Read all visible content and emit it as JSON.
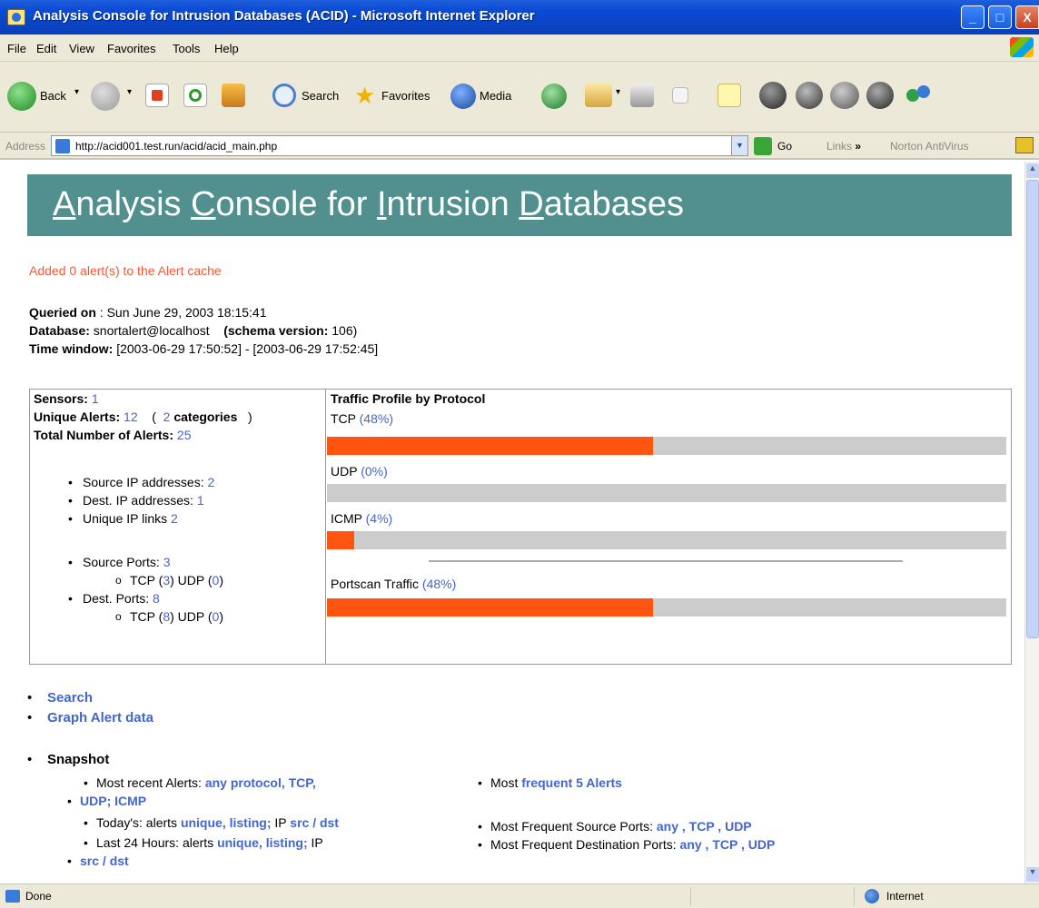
{
  "window": {
    "title": "Analysis Console for Intrusion Databases (ACID) - Microsoft Internet Explorer",
    "buttons": {
      "minimize": "_",
      "maximize": "□",
      "close": "X"
    }
  },
  "menu": [
    "File",
    "Edit",
    "View",
    "Favorites",
    "Tools",
    "Help"
  ],
  "toolbar": {
    "back": "Back",
    "search": "Search",
    "favorites": "Favorites",
    "media": "Media"
  },
  "address": {
    "label": "Address",
    "url": "http://acid001.test.run/acid/acid_main.php",
    "go": "Go",
    "links": "Links",
    "links_chevron": "»",
    "norton": "Norton AntiVirus"
  },
  "page": {
    "banner": {
      "w1_first": "A",
      "w1_rest": "nalysis ",
      "w2_first": "C",
      "w2_rest": "onsole for ",
      "w3_first": "I",
      "w3_rest": "ntrusion ",
      "w4_first": "D",
      "w4_rest": "atabases"
    },
    "cache_message": "Added 0 alert(s) to the Alert cache",
    "queried_on": {
      "label": "Queried on",
      "value": " : Sun June 29, 2003 18:15:41"
    },
    "database": {
      "label": "Database:",
      "value": " snortalert@localhost",
      "schema_label": "(schema version:",
      "schema_value": " 106)"
    },
    "time_window": {
      "label": "Time window:",
      "value": " [2003-06-29 17:50:52] - [2003-06-29 17:52:45]"
    },
    "stats": {
      "sensors": {
        "label": "Sensors:",
        "value": "1"
      },
      "unique_alerts": {
        "label": "Unique Alerts:",
        "value": "12",
        "paren_open": "(",
        "categories_value": "2",
        "categories_label": "categories",
        "paren_close": ")"
      },
      "total_alerts": {
        "label": "Total Number of Alerts:",
        "value": "25"
      },
      "src_ip": {
        "label": "Source IP addresses:",
        "value": "2"
      },
      "dst_ip": {
        "label": "Dest. IP addresses:",
        "value": "1"
      },
      "ip_links": {
        "label": "Unique IP links",
        "value": "2"
      },
      "src_ports": {
        "label": "Source Ports:",
        "value": "3",
        "tcp_label": "TCP (",
        "tcp": "3",
        "udp_label": ") UDP (",
        "udp": "0",
        "close": ")"
      },
      "dst_ports": {
        "label": "Dest. Ports:",
        "value": "8",
        "tcp_label": "TCP (",
        "tcp": "8",
        "udp_label": ") UDP (",
        "udp": "0",
        "close": ")"
      }
    },
    "traffic": {
      "title": "Traffic Profile by Protocol",
      "protocols": [
        {
          "name": "TCP",
          "pct_text": "(48%)",
          "fraction": 0.48
        },
        {
          "name": "UDP",
          "pct_text": "(0%)",
          "fraction": 0.0
        },
        {
          "name": "ICMP",
          "pct_text": "(4%)",
          "fraction": 0.04
        }
      ],
      "portscan": {
        "name": "Portscan Traffic",
        "pct_text": "(48%)",
        "fraction": 0.48
      }
    },
    "nav": {
      "search": "Search",
      "graph": "Graph Alert data"
    },
    "snapshot": {
      "title": "Snapshot",
      "recent_label": "Most recent Alerts:",
      "recent_any": "any protocol",
      "recent_tcp": "TCP",
      "recent_udp": "UDP",
      "recent_icmp": "ICMP",
      "today_label": "Today's: alerts",
      "today_unique": "unique",
      "today_listing": "listing",
      "today_ip": "IP",
      "today_srcdst": "src / dst",
      "last24_label": "Last 24 Hours: alerts",
      "last24_unique": "unique",
      "last24_listing": "listing",
      "last24_ip": "IP",
      "last24_srcdst": "src / dst",
      "most_label": "Most",
      "most_link": "frequent 5 Alerts",
      "src_ports_label": "Most Frequent Source Ports:",
      "dst_ports_label": "Most Frequent Destination Ports:",
      "any": "any",
      "tcp": "TCP",
      "udp": "UDP"
    }
  },
  "status": {
    "text": "Done",
    "zone": "Internet"
  }
}
